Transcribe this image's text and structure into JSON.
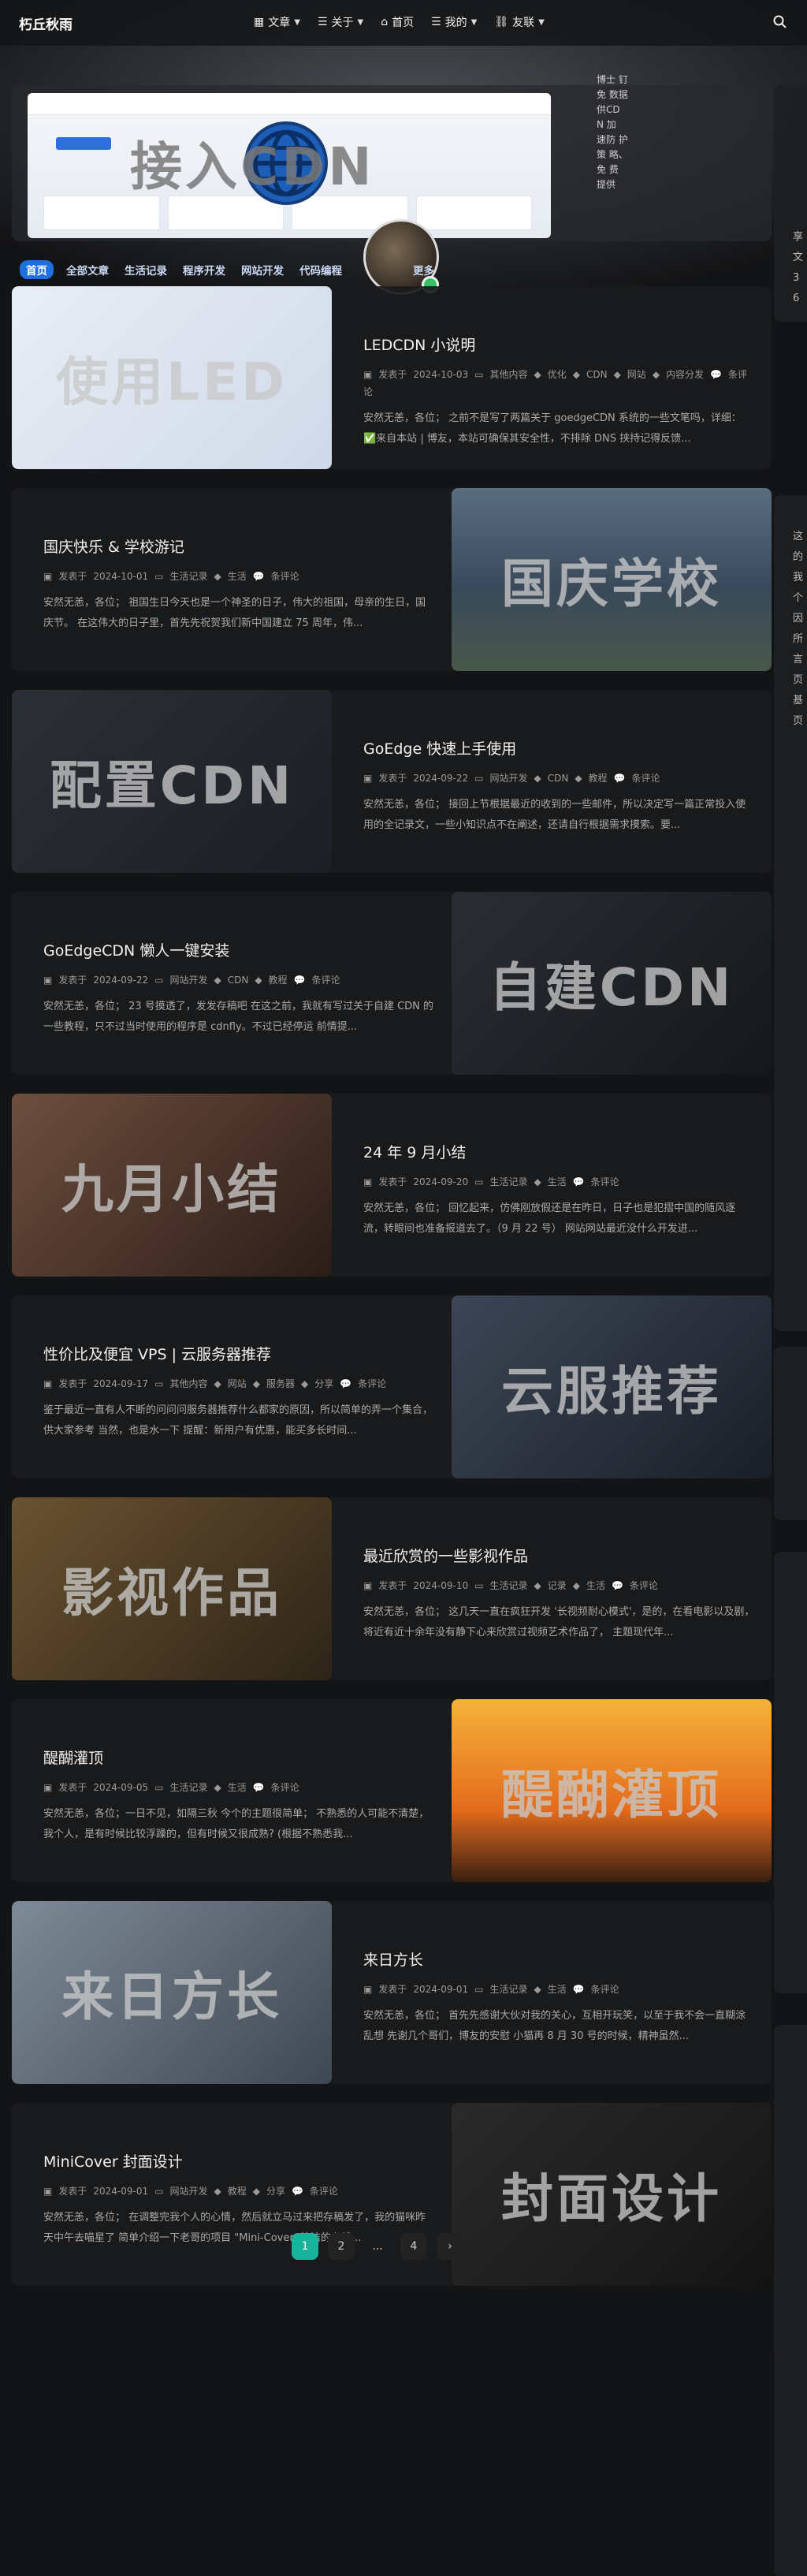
{
  "header": {
    "site_title": "朽丘秋雨",
    "nav": [
      {
        "label": "文章",
        "icon": "folder-icon",
        "has_dropdown": true
      },
      {
        "label": "关于",
        "icon": "list-icon",
        "has_dropdown": true
      },
      {
        "label": "首页",
        "icon": "home-icon",
        "has_dropdown": false
      },
      {
        "label": "我的",
        "icon": "list-icon",
        "has_dropdown": true
      },
      {
        "label": "友联",
        "icon": "link-icon",
        "has_dropdown": true
      }
    ]
  },
  "hero": {
    "title": "接入CDN",
    "side_text": "博士 钉免 数据 供CD N 加 速防 护策 略、免 费 提供"
  },
  "tabs": [
    "首页",
    "全部文章",
    "生活记录",
    "程序开发",
    "网站开发",
    "代码编程",
    "更多"
  ],
  "posts": [
    {
      "title": "LEDCDN 小说明",
      "thumb_text": "使用LED",
      "date": "2024-10-03",
      "category": "其他内容",
      "tags": [
        "优化",
        "CDN",
        "网站",
        "内容分发"
      ],
      "comments": "条评论",
      "excerpt": "安然无恙，各位； 之前不是写了两篇关于 goedgeCDN 系统的一些文笔吗，详细： ✅来自本站 | 博友，本站可确保其安全性，不排除 DNS 挟持记得反馈..."
    },
    {
      "title": "国庆快乐 & 学校游记",
      "thumb_text": "国庆学校",
      "date": "2024-10-01",
      "category": "生活记录",
      "tags": [
        "生活"
      ],
      "comments": "条评论",
      "excerpt": "安然无恙，各位； 祖国生日今天也是一个神圣的日子，伟大的祖国，母亲的生日，国庆节。 在这伟大的日子里，首先先祝贺我们新中国建立 75 周年，伟..."
    },
    {
      "title": "GoEdge 快速上手使用",
      "thumb_text": "配置CDN",
      "date": "2024-09-22",
      "category": "网站开发",
      "tags": [
        "CDN",
        "教程"
      ],
      "comments": "条评论",
      "excerpt": "安然无恙，各位； 接回上节根据最近的收到的一些邮件，所以决定写一篇正常投入使用的全记录文，一些小知识点不在阐述，还请自行根据需求摸索。要..."
    },
    {
      "title": "GoEdgeCDN 懒人一键安装",
      "thumb_text": "自建CDN",
      "date": "2024-09-22",
      "category": "网站开发",
      "tags": [
        "CDN",
        "教程"
      ],
      "comments": "条评论",
      "excerpt": "安然无恙，各位； 23 号摸透了，发发存稿吧 在这之前，我就有写过关于自建 CDN 的一些教程，只不过当时使用的程序是 cdnfly。不过已经停运 前情提..."
    },
    {
      "title": "24 年 9 月小结",
      "thumb_text": "九月小结",
      "date": "2024-09-20",
      "category": "生活记录",
      "tags": [
        "生活"
      ],
      "comments": "条评论",
      "excerpt": "安然无恙，各位； 回忆起来，仿佛刚放假还是在昨日，日子也是犯摺中国的随风逐流，转眼间也准备报道去了。（9 月 22 号） 网站网站最近没什么开发进..."
    },
    {
      "title": "性价比及便宜 VPS | 云服务器推荐",
      "thumb_text": "云服推荐",
      "date": "2024-09-17",
      "category": "其他内容",
      "tags": [
        "网站",
        "服务器",
        "分享"
      ],
      "comments": "条评论",
      "excerpt": "鉴于最近一直有人不断的问问问服务器推荐什么都家的原因，所以简单的弄一个集合，供大家参考 当然，也是水一下 提醒：新用户有优惠，能买多长时间..."
    },
    {
      "title": "最近欣赏的一些影视作品",
      "thumb_text": "影视作品",
      "date": "2024-09-10",
      "category": "生活记录",
      "tags": [
        "记录",
        "生活"
      ],
      "comments": "条评论",
      "excerpt": "安然无恙，各位； 这几天一直在疯狂开发 '长视频耐心模式'，是的，在看电影以及剧，将近有近十余年没有静下心来欣赏过视频艺术作品了， 主题现代年..."
    },
    {
      "title": "醍醐灌顶",
      "thumb_text": "醍醐灌顶",
      "date": "2024-09-05",
      "category": "生活记录",
      "tags": [
        "生活"
      ],
      "comments": "条评论",
      "excerpt": "安然无恙，各位；一日不见，如隔三秋 今个的主题很简单； 不熟悉的人可能不清楚，我个人，是有时候比较浮躁的，但有时候又很成熟? (根据不熟悉我..."
    },
    {
      "title": "来日方长",
      "thumb_text": "来日方长",
      "date": "2024-09-01",
      "category": "生活记录",
      "tags": [
        "生活"
      ],
      "comments": "条评论",
      "excerpt": "安然无恙，各位； 首先先感谢大伙对我的关心，互相开玩笑，以至于我不会一直糊涂乱想 先谢几个哥们，博友的安慰 小猫再 8 月 30 号的时候，精神虽然..."
    },
    {
      "title": "MiniCover 封面设计",
      "thumb_text": "封面设计",
      "date": "2024-09-01",
      "category": "网站开发",
      "tags": [
        "教程",
        "分享"
      ],
      "comments": "条评论",
      "excerpt": "安然无恙，各位； 在调整完我个人的心情，然后就立马过来把存稿发了，我的猫咪昨天中午去喵星了 简单介绍一下老哥的项目 \"Mini-Cover: 简洁的在线..."
    }
  ],
  "meta_labels": {
    "published": "发表于"
  },
  "pagination": [
    "1",
    "2",
    "...",
    "4",
    "›"
  ],
  "sidebar_snippets": [
    "享",
    "文",
    "3",
    "6",
    "这",
    "的",
    "我",
    "个",
    "因",
    "所",
    "言",
    "页",
    "基",
    "页"
  ],
  "colors": {
    "accent": "#1e6fe0",
    "pager_active": "#19b39b",
    "online": "#38c26a"
  }
}
